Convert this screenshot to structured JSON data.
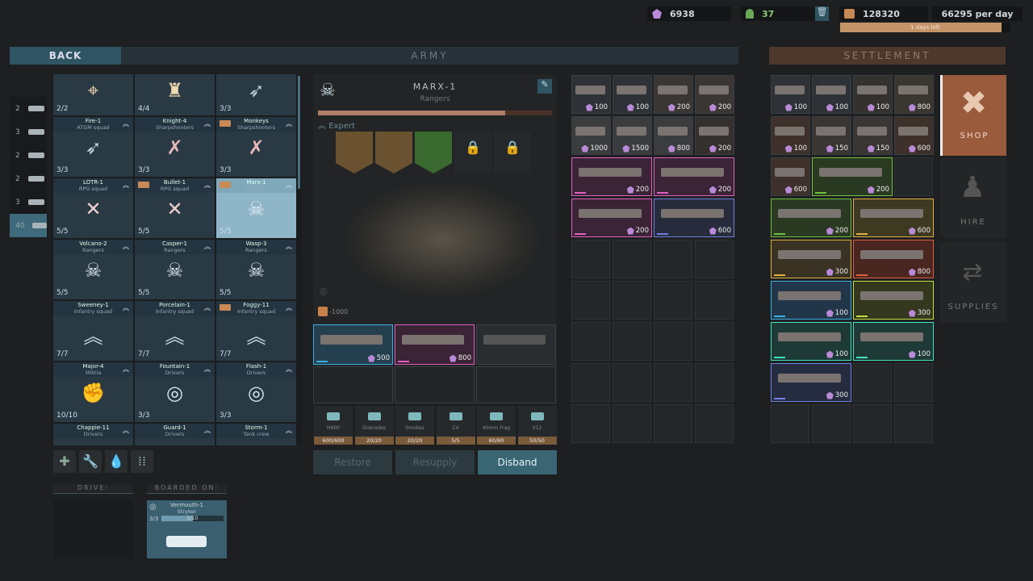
{
  "resources": {
    "crystals": "6938",
    "personnel": "37",
    "money": "128320",
    "income": "66295 per day",
    "days_left": "1 days left",
    "days_progress": 0.95
  },
  "header": {
    "back": "BACK",
    "army": "ARMY",
    "settlement": "SETTLEMENT"
  },
  "categories": [
    {
      "count": "2",
      "icon": "helicopter-icon"
    },
    {
      "count": "3",
      "icon": "artillery-icon"
    },
    {
      "count": "2",
      "icon": "tank-icon"
    },
    {
      "count": "2",
      "icon": "ifv-icon"
    },
    {
      "count": "3",
      "icon": "apc-icon"
    },
    {
      "count": "40",
      "icon": "infantry-icon",
      "active": true
    }
  ],
  "units": [
    {
      "name": "",
      "type": "",
      "count": "2/2",
      "icon": "⌖",
      "color": "#f0d8b0"
    },
    {
      "name": "",
      "type": "",
      "count": "4/4",
      "icon": "♜",
      "color": "#f0d8b0"
    },
    {
      "name": "",
      "type": "",
      "count": "3/3",
      "icon": "➶",
      "color": "#b8d4e0"
    },
    {
      "name": "Fire-1",
      "type": "ATGM squad",
      "count": "3/3",
      "icon": "➶",
      "color": "#b8d4e0"
    },
    {
      "name": "Knight-4",
      "type": "Sharpshooters",
      "count": "3/3",
      "icon": "✗",
      "color": "#e8b8b8"
    },
    {
      "name": "Monkeys",
      "type": "Sharpshooters",
      "count": "3/3",
      "icon": "✗",
      "color": "#e8b8b8",
      "truck": true
    },
    {
      "name": "LOTR-1",
      "type": "RPG squad",
      "count": "5/5",
      "icon": "✕",
      "color": "#f0d0d0"
    },
    {
      "name": "Bullet-1",
      "type": "RPG squad",
      "count": "5/5",
      "icon": "✕",
      "color": "#f0d0d0",
      "truck": true
    },
    {
      "name": "Marx-1",
      "type": "Rangers",
      "count": "5/5",
      "icon": "☠",
      "color": "#e0eef4",
      "truck": true,
      "selected": true
    },
    {
      "name": "Volcano-2",
      "type": "Rangers",
      "count": "5/5",
      "icon": "☠",
      "color": "#e0eef4"
    },
    {
      "name": "Casper-1",
      "type": "Rangers",
      "count": "5/5",
      "icon": "☠",
      "color": "#e0eef4"
    },
    {
      "name": "Wasp-3",
      "type": "Rangers",
      "count": "5/5",
      "icon": "☠",
      "color": "#e0eef4"
    },
    {
      "name": "Sweeney-1",
      "type": "Infantry squad",
      "count": "7/7",
      "icon": "︽",
      "color": "#c8dde6"
    },
    {
      "name": "Porcelain-1",
      "type": "Infantry squad",
      "count": "7/7",
      "icon": "︽",
      "color": "#c8dde6"
    },
    {
      "name": "Foggy-11",
      "type": "Infantry squad",
      "count": "7/7",
      "icon": "︽",
      "color": "#c8dde6",
      "truck": true
    },
    {
      "name": "Major-4",
      "type": "Militia",
      "count": "10/10",
      "icon": "✊",
      "color": "#c45a4a"
    },
    {
      "name": "Fountain-1",
      "type": "Drivers",
      "count": "3/3",
      "icon": "◎",
      "color": "#d8e8ee"
    },
    {
      "name": "Flash-1",
      "type": "Drivers",
      "count": "3/3",
      "icon": "◎",
      "color": "#d8e8ee"
    },
    {
      "name": "Chappie-11",
      "type": "Drivers",
      "count": "",
      "icon": "",
      "color": "#ccc"
    },
    {
      "name": "Guard-1",
      "type": "Drivers",
      "count": "",
      "icon": "",
      "color": "#ccc"
    },
    {
      "name": "Storm-1",
      "type": "Tank crew",
      "count": "",
      "icon": "",
      "color": "#ccc"
    }
  ],
  "detail": {
    "name": "MARX-1",
    "type": "Rangers",
    "rank": "Expert",
    "xp_progress": 0.8,
    "cost": "-1000",
    "weapons": [
      {
        "price": "500",
        "rarity": "#3ab0e0",
        "bg": "#24404e"
      },
      {
        "price": "800",
        "rarity": "#e060c0",
        "bg": "#3a2436"
      },
      {
        "price": "",
        "rarity": "",
        "bg": "#2a2d30"
      }
    ],
    "ammo": [
      {
        "name": "H900",
        "value": "600/600"
      },
      {
        "name": "Grenades",
        "value": "20/20"
      },
      {
        "name": "Smokes",
        "value": "20/20"
      },
      {
        "name": "C4",
        "value": "5/5"
      },
      {
        "name": "40mm Frag",
        "value": "60/60"
      },
      {
        "name": "X12",
        "value": "50/50"
      }
    ],
    "buttons": {
      "restore": "Restore",
      "resupply": "Resupply",
      "disband": "Disband"
    }
  },
  "drive": {
    "label": "DRIVE:"
  },
  "boarded": {
    "label": "BOARDED ON:",
    "name": "Vermouth-1",
    "type": "Stryker",
    "crew": "3/3",
    "capacity": "5/10",
    "capacity_fraction": 0.5
  },
  "inventory": [
    {
      "price": "100",
      "w": 1,
      "bg": "#2e3236"
    },
    {
      "price": "100",
      "w": 1,
      "bg": "#2e3236"
    },
    {
      "price": "200",
      "w": 1,
      "bg": "#3a3634"
    },
    {
      "price": "200",
      "w": 1,
      "bg": "#3a3634"
    },
    {
      "price": "1000",
      "w": 1,
      "bg": "#3a3c3e"
    },
    {
      "price": "1500",
      "w": 1,
      "bg": "#3a3c3e"
    },
    {
      "price": "800",
      "w": 1,
      "bg": "#3a3c3e"
    },
    {
      "price": "200",
      "w": 1,
      "bg": "#34302e"
    },
    {
      "price": "200",
      "w": 2,
      "bg": "#3a2436",
      "rarity": "#e060c0"
    },
    {
      "price": "200",
      "w": 2,
      "bg": "#3a2436",
      "rarity": "#e060c0"
    },
    {
      "price": "200",
      "w": 2,
      "bg": "#3a2436",
      "rarity": "#e060c0"
    },
    {
      "price": "600",
      "w": 2,
      "bg": "#262c3c",
      "rarity": "#7080e0"
    }
  ],
  "shop": [
    {
      "price": "100",
      "w": 1,
      "bg": "#2e3236"
    },
    {
      "price": "100",
      "w": 1,
      "bg": "#2e3236"
    },
    {
      "price": "100",
      "w": 1,
      "bg": "#34322e"
    },
    {
      "price": "800",
      "w": 1,
      "bg": "#3a3630"
    },
    {
      "price": "100",
      "w": 1,
      "bg": "#3e302a"
    },
    {
      "price": "150",
      "w": 1,
      "bg": "#3a3634"
    },
    {
      "price": "150",
      "w": 1,
      "bg": "#3a3634"
    },
    {
      "price": "600",
      "w": 1,
      "bg": "#3e302a"
    },
    {
      "price": "600",
      "w": 1,
      "bg": "#3e302a"
    },
    {
      "price": "200",
      "w": 2,
      "bg": "#2a3a22",
      "rarity": "#70c040"
    },
    {
      "price": "200",
      "w": 2,
      "bg": "#2a3a22",
      "rarity": "#70c040"
    },
    {
      "price": "600",
      "w": 2,
      "bg": "#3e3a22",
      "rarity": "#e0b040"
    },
    {
      "price": "300",
      "w": 2,
      "bg": "#3a3222",
      "rarity": "#e0b040"
    },
    {
      "price": "800",
      "w": 2,
      "bg": "#4a2620",
      "rarity": "#e06040"
    },
    {
      "price": "100",
      "w": 2,
      "bg": "#22364a",
      "rarity": "#3ab0e0"
    },
    {
      "price": "300",
      "w": 2,
      "bg": "#34381e",
      "rarity": "#c0e040"
    },
    {
      "price": "100",
      "w": 2,
      "bg": "#1e3a36",
      "rarity": "#40e0c0"
    },
    {
      "price": "100",
      "w": 2,
      "bg": "#1e3a36",
      "rarity": "#40e0c0"
    },
    {
      "price": "300",
      "w": 2,
      "bg": "#262c40",
      "rarity": "#7080e0"
    }
  ],
  "side_tabs": {
    "shop": "SHOP",
    "hire": "HIRE",
    "supplies": "SUPPLIES"
  }
}
